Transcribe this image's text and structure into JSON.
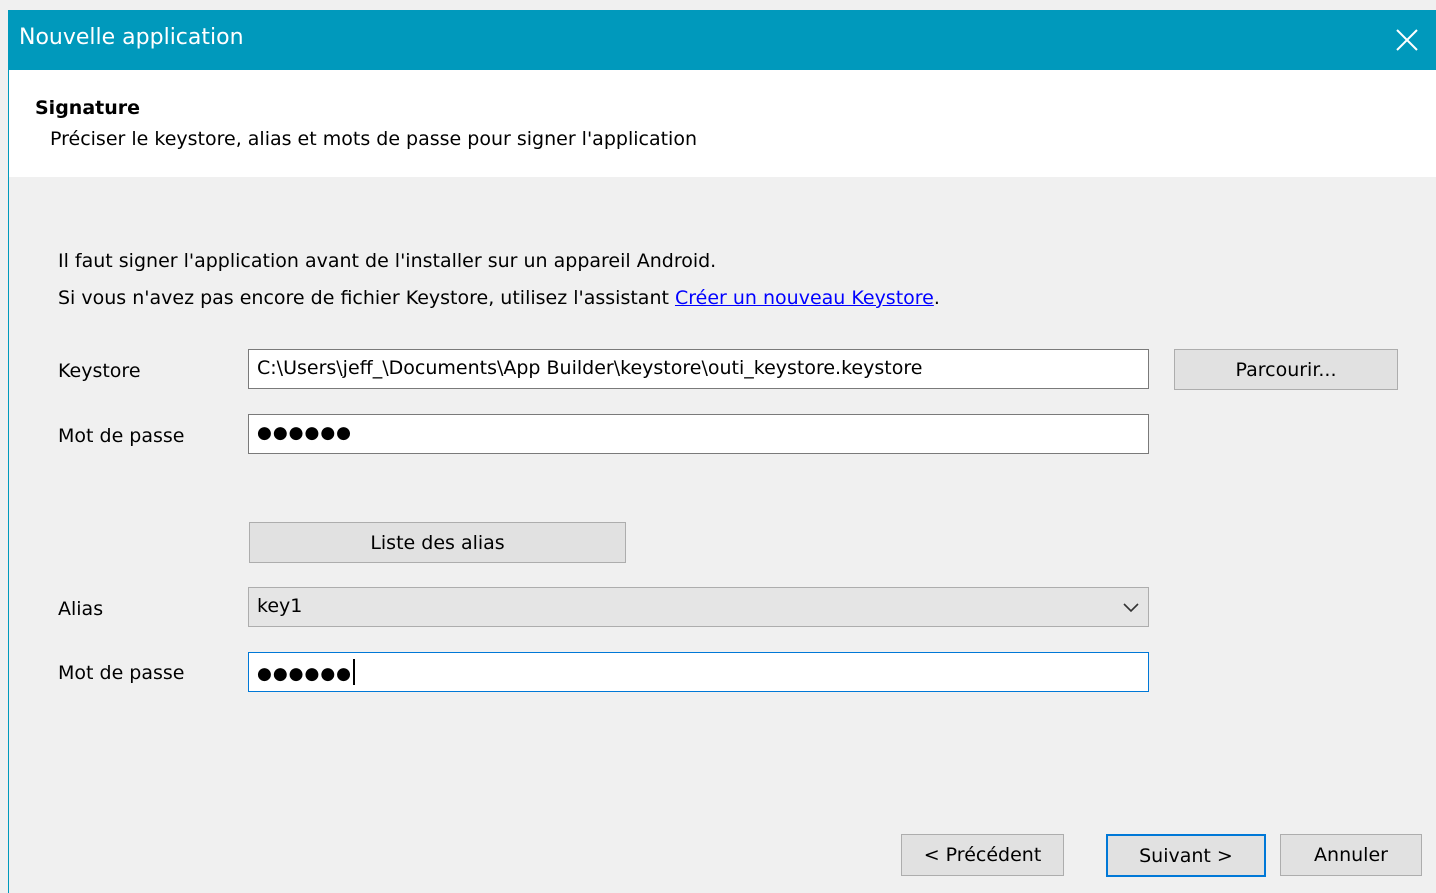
{
  "window": {
    "title": "Nouvelle application",
    "close_icon": "close-icon"
  },
  "header": {
    "title": "Signature",
    "subtitle": "Préciser le keystore, alias et mots de passe pour signer l'application"
  },
  "intro": {
    "line1": "Il faut signer l'application avant de l'installer sur un appareil Android.",
    "line2_prefix": "Si vous n'avez pas encore de fichier Keystore, utilisez l'assistant ",
    "line2_link": "Créer un nouveau Keystore",
    "line2_suffix": "."
  },
  "keystore": {
    "label": "Keystore",
    "value": "C:\\Users\\jeff_\\Documents\\App Builder\\keystore\\outi_keystore.keystore",
    "browse_label": "Parcourir..."
  },
  "keystore_password": {
    "label": "Mot de passe",
    "value": "●●●●●●"
  },
  "alias_list_button": "Liste des alias",
  "alias": {
    "label": "Alias",
    "selected": "key1",
    "dropdown_icon": "chevron-down-icon"
  },
  "alias_password": {
    "label": "Mot de passe",
    "value": "●●●●●●"
  },
  "footer": {
    "previous_label": "< Précédent",
    "next_label": "Suivant >",
    "cancel_label": "Annuler"
  },
  "colors": {
    "title_bar": "#0099bc",
    "focus_border": "#0078d7",
    "link": "#0000ff"
  }
}
